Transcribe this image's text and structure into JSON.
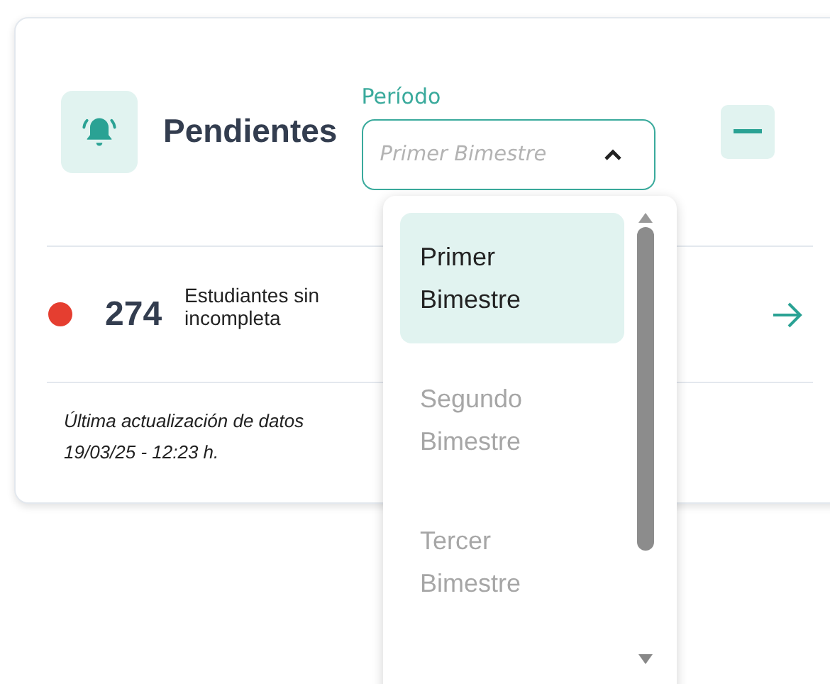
{
  "card": {
    "title": "Pendientes",
    "period": {
      "label": "Período",
      "placeholder": "Primer Bimestre",
      "expanded": true,
      "options": [
        {
          "label": "Primer Bimestre",
          "selected": true
        },
        {
          "label": "Segundo Bimestre",
          "selected": false
        },
        {
          "label": "Tercer Bimestre",
          "selected": false
        }
      ]
    },
    "alert": {
      "count": "274",
      "description_lines": [
        "Estudiantes sin",
        "incompleta"
      ]
    },
    "footer_lines": [
      "Última actualización de datos",
      "19/03/25 - 12:23 h."
    ]
  }
}
